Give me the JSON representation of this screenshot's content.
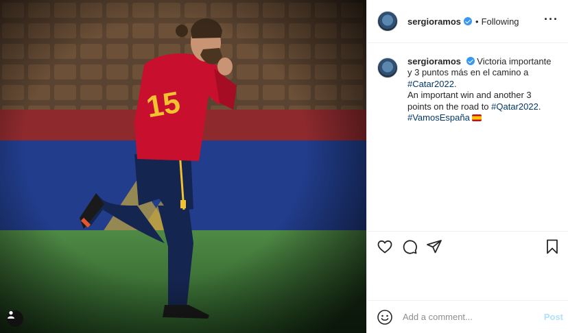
{
  "post": {
    "photo_label": "Football player in red Spain kit number 15 running on the pitch",
    "jersey_number": "15"
  },
  "header": {
    "username": "sergioramos",
    "verified": true,
    "separator": "•",
    "follow_state": "Following",
    "more_icon": "more-horizontal-icon"
  },
  "caption": {
    "username": "sergioramos",
    "text_line1": "Victoria importante y 3 puntos más en el camino a ",
    "hashtag1": "#Catar2022",
    "text_line2": "An important win and another 3 points on the road to ",
    "hashtag2": "#Qatar2022",
    "text_line2_end": ".",
    "hashtag3": "#VamosEspaña",
    "flag_icon": "spain-flag-icon"
  },
  "actions": {
    "like_icon": "heart-icon",
    "comment_icon": "comment-icon",
    "share_icon": "share-icon",
    "save_icon": "bookmark-icon"
  },
  "comment": {
    "placeholder": "Add a comment...",
    "post_label": "Post",
    "emoji_icon": "emoji-icon"
  },
  "colors": {
    "hashtag": "#00376b",
    "verified": "#3897f0",
    "post_disabled": "#b2dffc",
    "kit_red": "#c8102e",
    "kit_gold": "#f2c230",
    "kit_navy": "#14254f"
  }
}
